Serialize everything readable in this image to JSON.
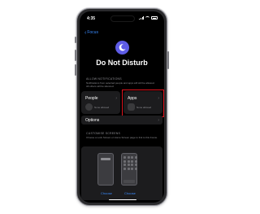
{
  "status_bar": {
    "time": "4:35"
  },
  "nav": {
    "back_label": "Focus"
  },
  "header": {
    "title": "Do Not Disturb"
  },
  "allow_notifications": {
    "section_label": "ALLOW NOTIFICATIONS",
    "description": "Notifications from selected people and apps will still be allowed. All others will be silenced.",
    "people": {
      "title": "People",
      "value": "None allowed"
    },
    "apps": {
      "title": "Apps",
      "value": "None allowed"
    }
  },
  "options": {
    "title": "Options"
  },
  "customise_screens": {
    "section_label": "CUSTOMISE SCREENS",
    "description": "Choose a Lock Screen or Home Screen page to link to this Focus.",
    "lock_choose_label": "Choose",
    "home_choose_label": "Choose"
  },
  "colors": {
    "accent": "#3a8bff",
    "moon_bg": "#5e5ce6",
    "highlight": "#e0141e"
  }
}
